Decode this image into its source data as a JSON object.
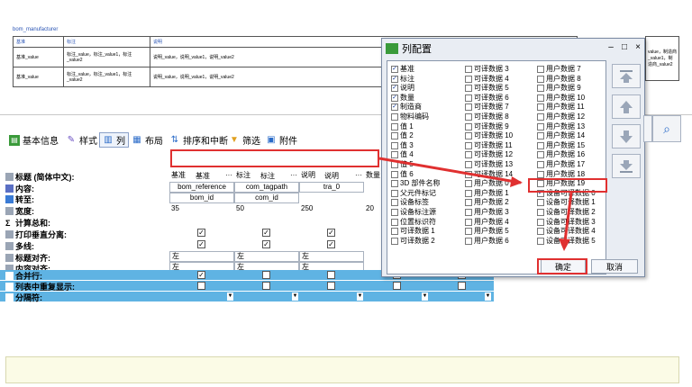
{
  "preview": {
    "caption": "bom_manufacturer",
    "headers": [
      "基准",
      "标注",
      "说明"
    ],
    "rows": [
      [
        "基准_value",
        "标注_value，标注_value1，标注_value2",
        "说明_value，说明_value1，说明_value2"
      ],
      [
        "基准_value",
        "标注_value，标注_value1，标注_value2",
        "说明_value，说明_value1，说明_value2"
      ]
    ],
    "extra_text": "value，制造商_value1，制造商_value2"
  },
  "tabs": [
    {
      "label": "基本信息",
      "icon": "info-icon"
    },
    {
      "label": "样式",
      "icon": "brush-icon"
    },
    {
      "label": "列",
      "icon": "columns-icon"
    },
    {
      "label": "布局",
      "icon": "layout-icon"
    },
    {
      "label": "排序和中断",
      "icon": "sort-icon"
    },
    {
      "label": "筛选",
      "icon": "filter-icon"
    },
    {
      "label": "附件",
      "icon": "attachment-icon"
    }
  ],
  "grid": {
    "column_headers": [
      "基准",
      "标注",
      "说明"
    ],
    "row_labels": [
      "标题 (简体中文):",
      "内容:",
      "转至:",
      "宽度:",
      "计算总和:",
      "打印垂直分离:",
      "多线:",
      "标题对齐:",
      "内容对齐:",
      "合并行:",
      "列表中重复显示:",
      "分隔符:"
    ],
    "title_cells": [
      "基准",
      "标注",
      "说明",
      "数量"
    ],
    "content_cells": [
      "bom_reference",
      "com_tagpath",
      "tra_0"
    ],
    "goto_cells": [
      "bom_id",
      "com_id"
    ],
    "width_cells": [
      "35",
      "50",
      "250",
      "20"
    ],
    "align_cells": [
      "左",
      "左",
      "左"
    ],
    "ellipsis": "···"
  },
  "dialog": {
    "title": "列配置",
    "minimize": "–",
    "maximize": "□",
    "close": "×",
    "col1": [
      {
        "label": "基准",
        "checked": true
      },
      {
        "label": "标注",
        "checked": true
      },
      {
        "label": "说明",
        "checked": true
      },
      {
        "label": "数量",
        "checked": true
      },
      {
        "label": "制造商",
        "checked": true
      },
      {
        "label": "物料编码",
        "checked": false
      },
      {
        "label": "值 1",
        "checked": false
      },
      {
        "label": "值 2",
        "checked": false
      },
      {
        "label": "值 3",
        "checked": false
      },
      {
        "label": "值 4",
        "checked": false
      },
      {
        "label": "值 5",
        "checked": false
      },
      {
        "label": "值 6",
        "checked": false
      },
      {
        "label": "3D 部件名称",
        "checked": false
      },
      {
        "label": "父元件标记",
        "checked": false
      },
      {
        "label": "设备标签",
        "checked": false
      },
      {
        "label": "设备标注源",
        "checked": false
      },
      {
        "label": "位置标识符",
        "checked": false
      },
      {
        "label": "可译数据 1",
        "checked": false
      },
      {
        "label": "可译数据 2",
        "checked": false
      }
    ],
    "col2": [
      {
        "label": "可译数据 3",
        "checked": false
      },
      {
        "label": "可译数据 4",
        "checked": false
      },
      {
        "label": "可译数据 5",
        "checked": false
      },
      {
        "label": "可译数据 6",
        "checked": false
      },
      {
        "label": "可译数据 7",
        "checked": false
      },
      {
        "label": "可译数据 8",
        "checked": false
      },
      {
        "label": "可译数据 9",
        "checked": false
      },
      {
        "label": "可译数据 10",
        "checked": false
      },
      {
        "label": "可译数据 11",
        "checked": false
      },
      {
        "label": "可译数据 12",
        "checked": false
      },
      {
        "label": "可译数据 13",
        "checked": false
      },
      {
        "label": "可译数据 14",
        "checked": false
      },
      {
        "label": "用户数据 0",
        "checked": false
      },
      {
        "label": "用户数据 1",
        "checked": false
      },
      {
        "label": "用户数据 2",
        "checked": false
      },
      {
        "label": "用户数据 3",
        "checked": false
      },
      {
        "label": "用户数据 4",
        "checked": false
      },
      {
        "label": "用户数据 5",
        "checked": false
      },
      {
        "label": "用户数据 6",
        "checked": false
      }
    ],
    "col3": [
      {
        "label": "用户数据 7",
        "checked": false
      },
      {
        "label": "用户数据 8",
        "checked": false
      },
      {
        "label": "用户数据 9",
        "checked": false
      },
      {
        "label": "用户数据 10",
        "checked": false
      },
      {
        "label": "用户数据 11",
        "checked": false
      },
      {
        "label": "用户数据 12",
        "checked": false
      },
      {
        "label": "用户数据 13",
        "checked": false
      },
      {
        "label": "用户数据 14",
        "checked": false
      },
      {
        "label": "用户数据 15",
        "checked": false
      },
      {
        "label": "用户数据 16",
        "checked": false
      },
      {
        "label": "用户数据 17",
        "checked": false
      },
      {
        "label": "用户数据 18",
        "checked": false
      },
      {
        "label": "用户数据 19",
        "checked": false
      },
      {
        "label": "设备可译数据 0",
        "checked": true
      },
      {
        "label": "设备可译数据 1",
        "checked": false
      },
      {
        "label": "设备可译数据 2",
        "checked": false
      },
      {
        "label": "设备可译数据 3",
        "checked": false
      },
      {
        "label": "设备可译数据 4",
        "checked": false
      },
      {
        "label": "设备可译数据 5",
        "checked": false
      }
    ],
    "ok_label": "确定",
    "cancel_label": "取消"
  },
  "colors": {
    "accent_blue": "#5fb3e3",
    "annotation_red": "#e03030",
    "bottom_panel": "#fbfbe6"
  }
}
